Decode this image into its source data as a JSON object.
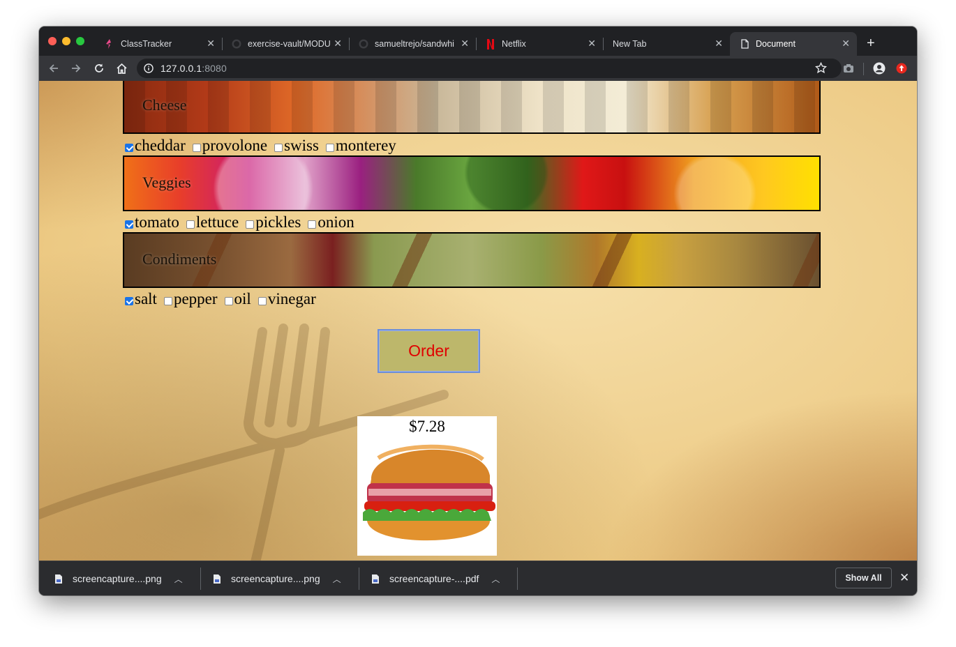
{
  "browser": {
    "tabs": [
      {
        "title": "ClassTracker",
        "icon": "classtracker-favicon"
      },
      {
        "title": "exercise-vault/MODU",
        "icon": "github-icon"
      },
      {
        "title": "samueltrejo/sandwhi",
        "icon": "github-icon"
      },
      {
        "title": "Netflix",
        "icon": "netflix-icon"
      },
      {
        "title": "New Tab",
        "icon": ""
      },
      {
        "title": "Document",
        "icon": "document-icon",
        "active": true
      }
    ],
    "url_host": "127.0.0.1",
    "url_port": ":8080"
  },
  "sections": [
    {
      "title": "Cheese",
      "options": [
        {
          "label": "cheddar",
          "checked": true
        },
        {
          "label": "provolone",
          "checked": false
        },
        {
          "label": "swiss",
          "checked": false
        },
        {
          "label": "monterey",
          "checked": false
        }
      ]
    },
    {
      "title": "Veggies",
      "options": [
        {
          "label": "tomato",
          "checked": true
        },
        {
          "label": "lettuce",
          "checked": false
        },
        {
          "label": "pickles",
          "checked": false
        },
        {
          "label": "onion",
          "checked": false
        }
      ]
    },
    {
      "title": "Condiments",
      "options": [
        {
          "label": "salt",
          "checked": true
        },
        {
          "label": "pepper",
          "checked": false
        },
        {
          "label": "oil",
          "checked": false
        },
        {
          "label": "vinegar",
          "checked": false
        }
      ]
    }
  ],
  "order_button": "Order",
  "price": "$7.28",
  "downloads": [
    {
      "name": "screencapture....png"
    },
    {
      "name": "screencapture....png"
    },
    {
      "name": "screencapture-....pdf"
    }
  ],
  "show_all": "Show All",
  "colors": {
    "order_bg": "#bdb76b",
    "order_text": "#e00000",
    "check_blue": "#1a73e8"
  }
}
